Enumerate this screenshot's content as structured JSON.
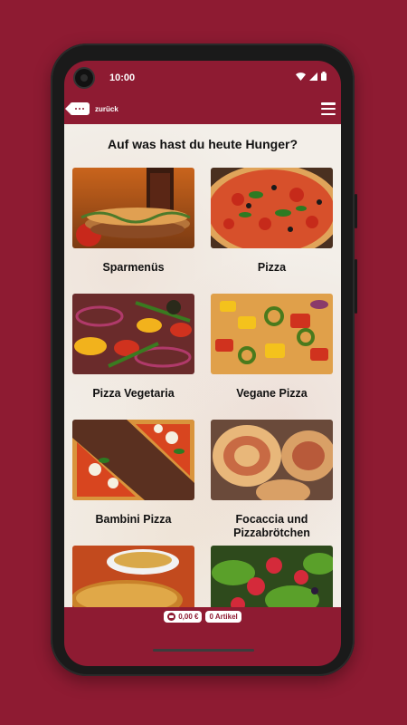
{
  "status": {
    "time": "10:00"
  },
  "appbar": {
    "back_label": "zurück"
  },
  "heading": "Auf was hast du heute Hunger?",
  "categories": [
    {
      "label": "Sparmenüs"
    },
    {
      "label": "Pizza"
    },
    {
      "label": "Pizza Vegetaria"
    },
    {
      "label": "Vegane Pizza"
    },
    {
      "label": "Bambini Pizza"
    },
    {
      "label": "Focaccia und Pizzabrötchen"
    },
    {
      "label": ""
    },
    {
      "label": ""
    }
  ],
  "footer": {
    "price": "0,00 €",
    "articles": "0 Artikel"
  },
  "colors": {
    "brand": "#8e1b32",
    "content_bg": "#f3efe9"
  }
}
